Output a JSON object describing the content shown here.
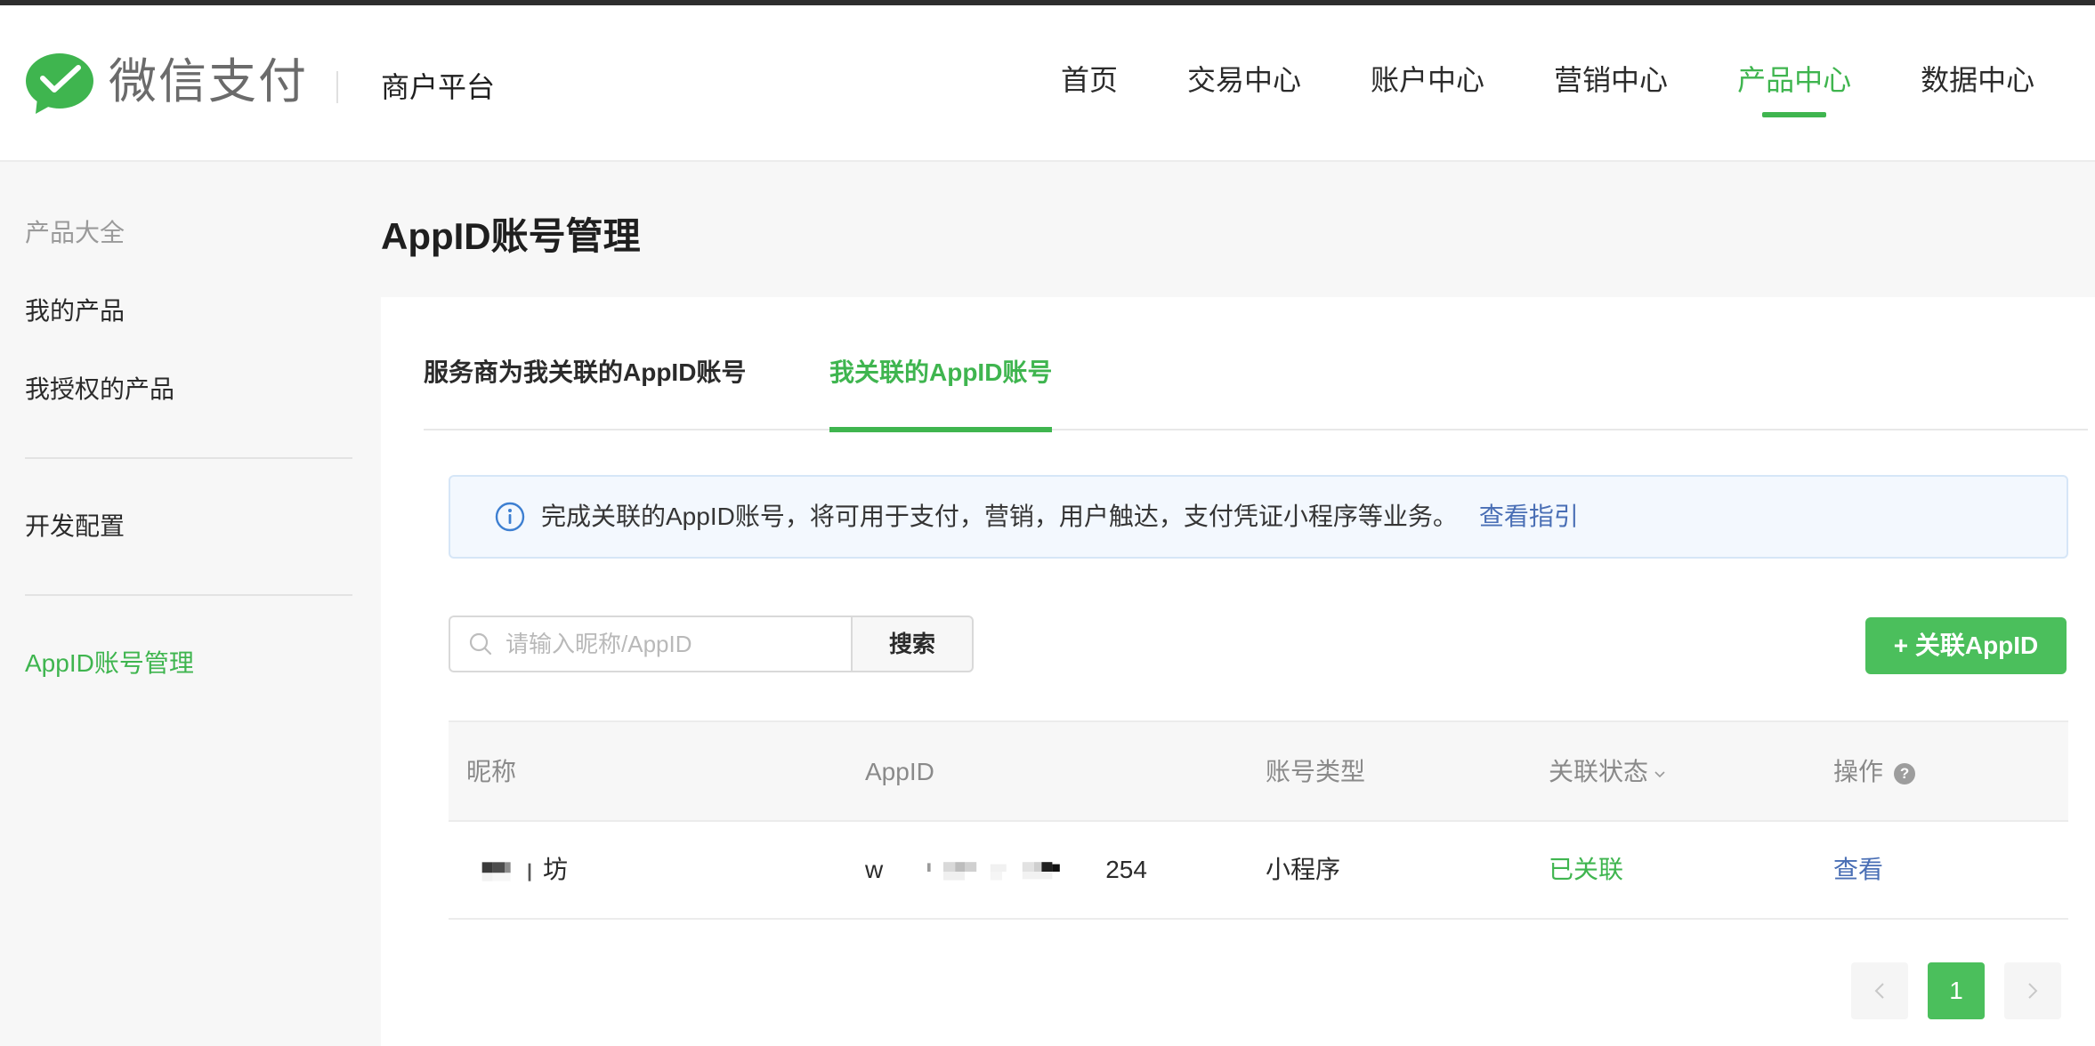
{
  "brand": {
    "logo_text": "微信支付",
    "platform_name": "商户平台",
    "color": "#3fb54f"
  },
  "nav": {
    "items": [
      {
        "label": "首页",
        "active": false
      },
      {
        "label": "交易中心",
        "active": false
      },
      {
        "label": "账户中心",
        "active": false
      },
      {
        "label": "营销中心",
        "active": false
      },
      {
        "label": "产品中心",
        "active": true
      },
      {
        "label": "数据中心",
        "active": false
      }
    ]
  },
  "sidebar": {
    "heading": "产品大全",
    "items": [
      {
        "label": "我的产品"
      },
      {
        "label": "我授权的产品"
      },
      {
        "label": "开发配置"
      },
      {
        "label": "AppID账号管理",
        "active": true
      }
    ]
  },
  "page": {
    "title": "AppID账号管理"
  },
  "tabs": [
    {
      "label": "服务商为我关联的AppID账号",
      "active": false
    },
    {
      "label": "我关联的AppID账号",
      "active": true
    }
  ],
  "notice": {
    "icon": "info-icon",
    "text": "完成关联的AppID账号，将可用于支付，营销，用户触达，支付凭证小程序等业务。",
    "link": "查看指引"
  },
  "search": {
    "placeholder": "请输入昵称/AppID",
    "value": "",
    "button_label": "搜索"
  },
  "add_button_label": "+ 关联AppID",
  "table": {
    "columns": [
      "昵称",
      "AppID",
      "账号类型",
      "关联状态",
      "操作"
    ],
    "rows": [
      {
        "nickname_suffix": "坊",
        "appid_prefix": "w",
        "appid_suffix": "254",
        "account_type": "小程序",
        "status": "已关联",
        "action": "查看"
      }
    ]
  },
  "pagination": {
    "prev_icon": "chevron-left-icon",
    "current_page": "1",
    "next_icon": "chevron-right-icon"
  }
}
